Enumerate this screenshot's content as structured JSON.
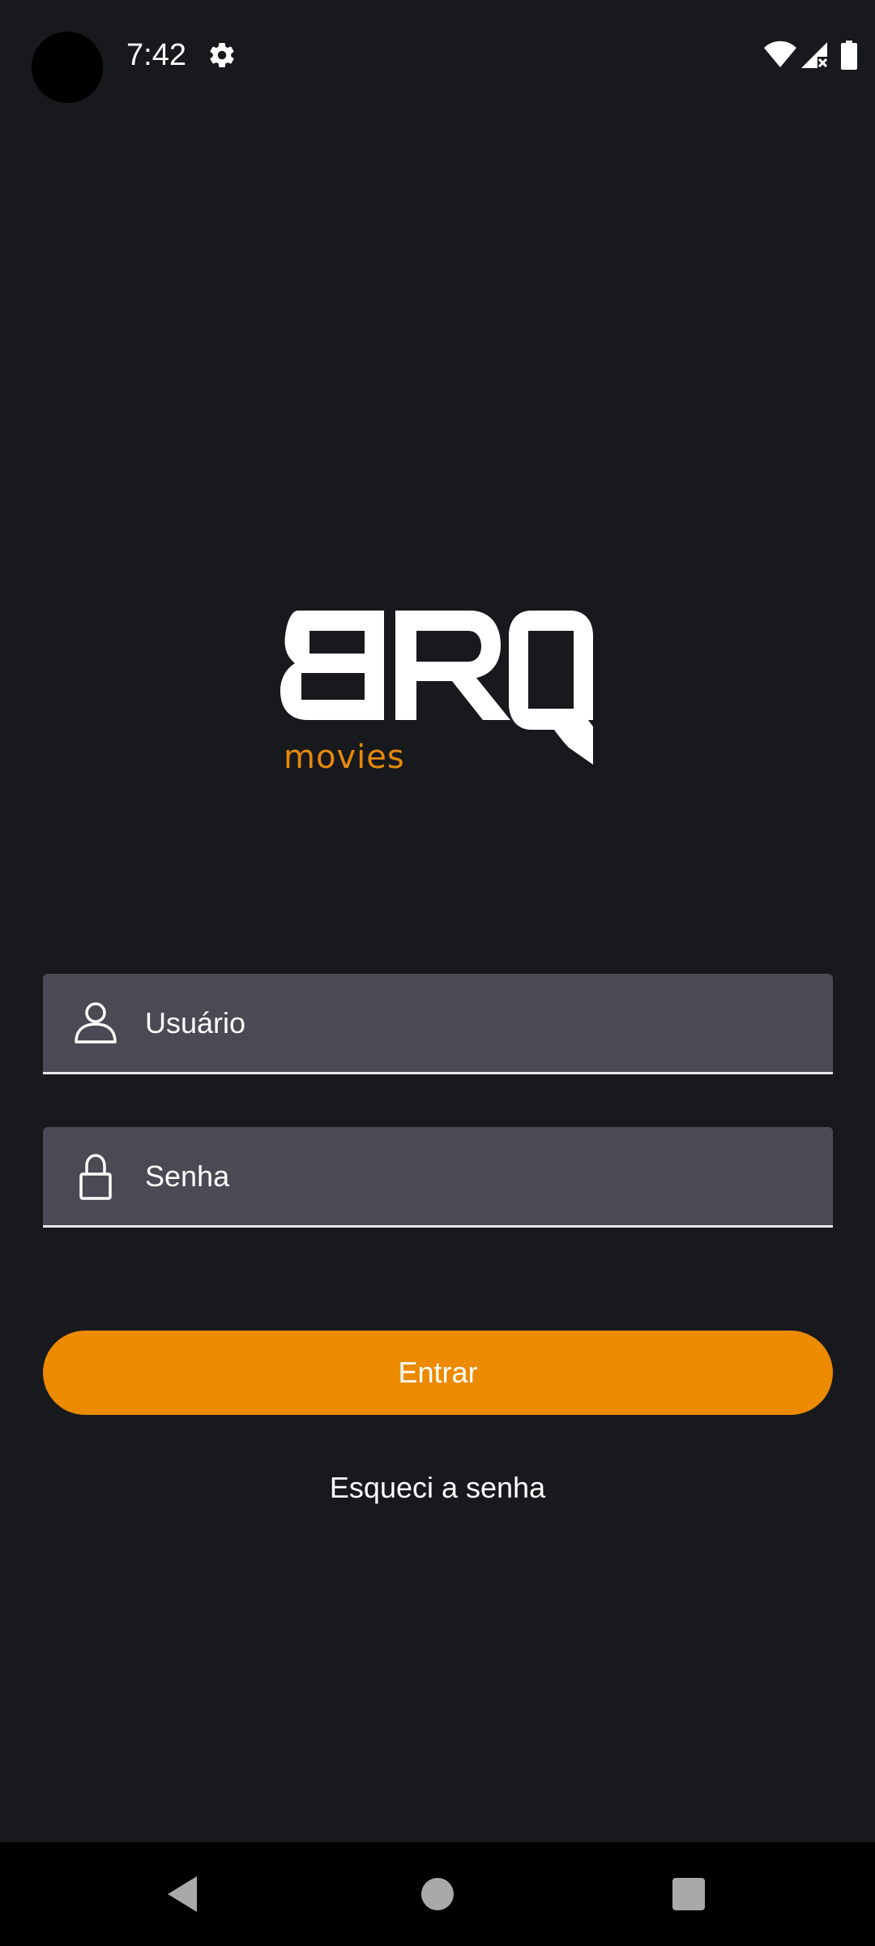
{
  "status_bar": {
    "time": "7:42",
    "icons": [
      "settings-icon",
      "wifi-icon",
      "signal-icon",
      "battery-icon"
    ]
  },
  "logo": {
    "text": "BRQ",
    "subtitle": "movies"
  },
  "form": {
    "username_placeholder": "Usuário",
    "password_placeholder": "Senha",
    "username_icon": "user-icon",
    "password_icon": "lock-icon"
  },
  "actions": {
    "login_label": "Entrar",
    "forgot_label": "Esqueci a senha"
  },
  "colors": {
    "background": "#18191d",
    "accent": "#ec8a00",
    "field": "#4b4954"
  },
  "nav": {
    "icons": [
      "back-icon",
      "home-icon",
      "recents-icon"
    ]
  }
}
